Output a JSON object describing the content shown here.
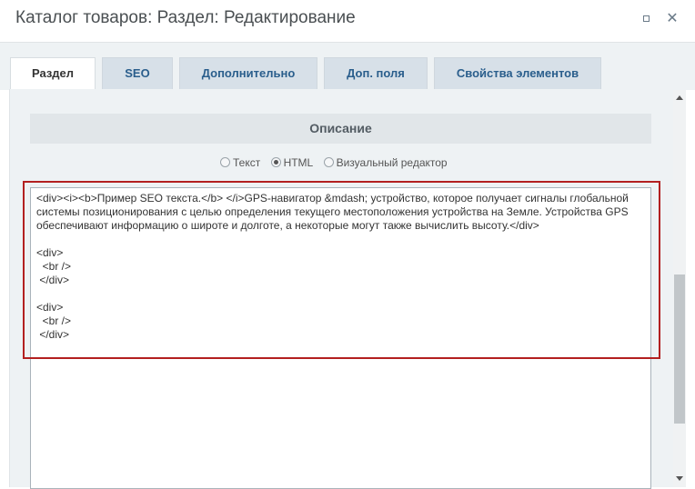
{
  "window": {
    "title": "Каталог товаров: Раздел: Редактирование"
  },
  "tabs": [
    {
      "label": "Раздел",
      "active": true
    },
    {
      "label": "SEO",
      "active": false
    },
    {
      "label": "Дополнительно",
      "active": false
    },
    {
      "label": "Доп. поля",
      "active": false
    },
    {
      "label": "Свойства элементов",
      "active": false
    }
  ],
  "section": {
    "title": "Описание"
  },
  "modes": {
    "text": "Текст",
    "html": "HTML",
    "visual": "Визуальный редактор",
    "selected": "HTML"
  },
  "editor": {
    "content": "<div><i><b>Пример SEO текста.</b> </i>GPS-навигатор &mdash; устройство, которое получает сигналы глобальной системы позиционирования с целью определения текущего местоположения устройства на Земле. Устройства GPS обеспечивают информацию о широте и долготе, а некоторые могут также вычислить высоту.</div>\n\n<div>\n  <br />\n </div>\n\n<div>\n  <br />\n </div>"
  },
  "colors": {
    "accent_tab_text": "#2a5e8c",
    "highlight_border": "#b32020"
  }
}
